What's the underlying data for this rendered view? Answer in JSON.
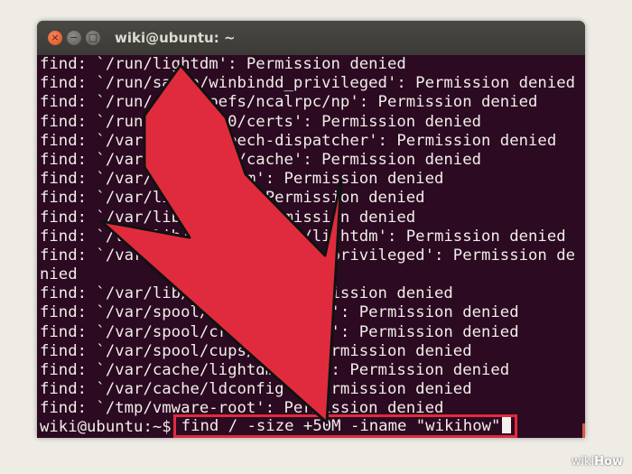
{
  "window": {
    "title": "wiki@ubuntu: ~",
    "buttons": {
      "close": "×",
      "minimize": "−",
      "maximize": "□"
    }
  },
  "terminal": {
    "lines": [
      "find: `/run/lightdm': Permission denied",
      "find: `/run/samba/winbindd_privileged': Permission denied",
      "find: `/run/rpc_pipefs/ncalrpc/np': Permission denied",
      "find: `/run/user/1000/certs': Permission denied",
      "find: `/var/spool/speech-dispatcher': Permission denied",
      "find: `/var/lib/samba/cache': Permission denied",
      "find: `/var/lib/lightdm': Permission denied",
      "find: `/var/lib/samba': Permission denied",
      "find: `/var/lib/sudo': Permission denied",
      "find: `/var/lib/lightdm-data/lightdm': Permission denied",
      "find: `/var/lib/samba/winbindd_privileged': Permission de",
      "nied",
      "find: `/var/lib/polkit-1': Permission denied",
      "find: `/var/spool/cron/crontabs': Permission denied",
      "find: `/var/spool/cron/crontabs': Permission denied",
      "find: `/var/spool/cups/tmp': Permission denied",
      "find: `/var/cache/lightdm/dmrc': Permission denied",
      "find: `/var/cache/ldconfig': Permission denied",
      "find: `/tmp/vmware-root': Permission denied"
    ],
    "prompt": "wiki@ubuntu:~$",
    "command": "find / -size +50M -iname \"wikihow\""
  },
  "watermark": {
    "prefix": "wiki",
    "suffix": "How"
  },
  "colors": {
    "terminal_bg": "#2c0a22",
    "arrow": "#e02b3e",
    "highlight_border": "#e02b3e",
    "text": "#f0ede8"
  }
}
